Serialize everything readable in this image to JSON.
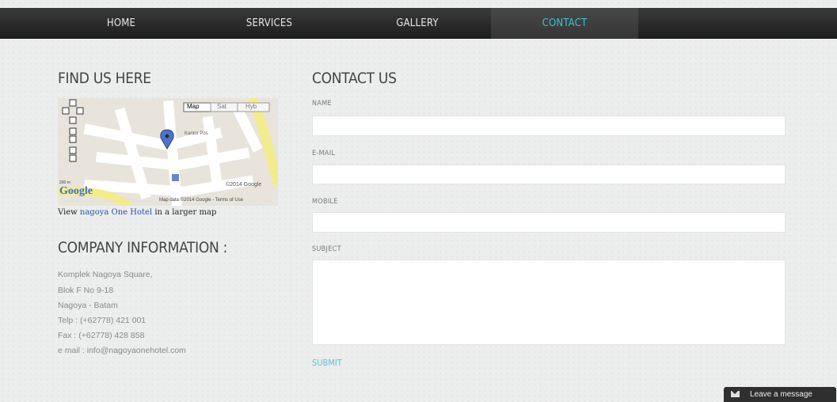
{
  "nav": {
    "items": [
      {
        "label": "HOME"
      },
      {
        "label": "SERVICES"
      },
      {
        "label": "GALLERY"
      },
      {
        "label": "CONTACT",
        "active": true
      }
    ]
  },
  "find_us": {
    "heading": "FIND US HERE",
    "map": {
      "type_buttons": [
        "Map",
        "Sat",
        "Hyb"
      ],
      "street_label": "Kantor Pos",
      "logo": "Google",
      "scale": "200 m",
      "attribution_right": "©2014 Google",
      "footer": "Map data ©2014 Google - Terms of Use"
    },
    "larger_map": {
      "prefix": "View ",
      "link": "nagoya One Hotel",
      "suffix": " in a larger map"
    }
  },
  "company": {
    "heading": "COMPANY INFORMATION :",
    "lines": [
      "Komplek Nagoya Square,",
      "Blok F No 9-18",
      "Nagoya - Batam",
      "Telp : (+62778) 421 001",
      "Fax : (+62778) 428 858",
      "e mail : info@nagoyaonehotel.com"
    ]
  },
  "contact": {
    "heading": "CONTACT US",
    "fields": {
      "name": {
        "label": "NAME",
        "value": ""
      },
      "email": {
        "label": "E-MAIL",
        "value": ""
      },
      "mobile": {
        "label": "MOBILE",
        "value": ""
      },
      "subject": {
        "label": "SUBJECT",
        "value": ""
      }
    },
    "submit": "SUBMIT"
  },
  "chat": {
    "label": "Leave a message",
    "icon": "envelope-icon"
  },
  "colors": {
    "accent": "#39c2d6",
    "nav_bg": "#262626",
    "page_bg": "#eceded"
  }
}
